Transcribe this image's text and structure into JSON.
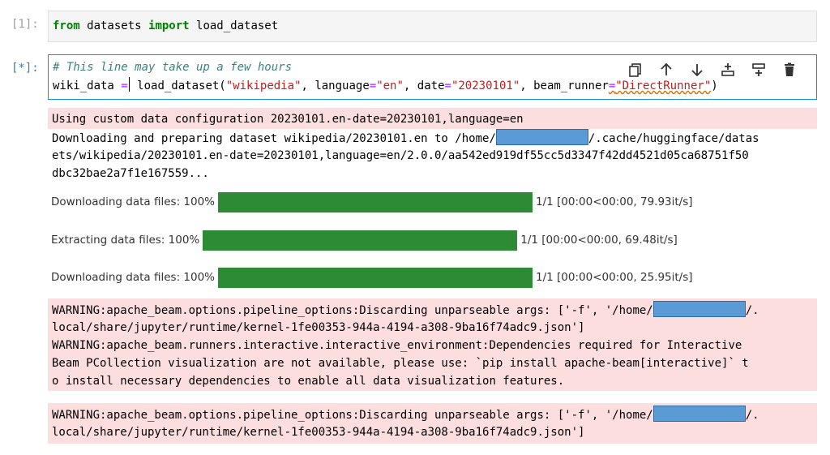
{
  "cells": [
    {
      "prompt": "[1]:",
      "code": {
        "kw1": "from",
        "mod": " datasets ",
        "kw2": "import",
        "rest": " load_dataset"
      }
    },
    {
      "prompt": "[*]:",
      "comment": "# This line may take up a few hours",
      "code_line": {
        "a": "wiki_data ",
        "eq": "=",
        "b": " load_dataset(",
        "s1": "\"wikipedia\"",
        "c": ", language",
        "eq2": "=",
        "s2": "\"en\"",
        "d": ", date",
        "eq3": "=",
        "s3": "\"20230101\"",
        "e": ", beam_runner",
        "eq4": "=",
        "s4": "\"DirectRunner\"",
        "f": ")"
      },
      "toolbar": [
        {
          "icon": "duplicate-icon"
        },
        {
          "icon": "move-up-icon"
        },
        {
          "icon": "move-down-icon"
        },
        {
          "icon": "insert-above-icon"
        },
        {
          "icon": "insert-below-icon"
        },
        {
          "icon": "delete-icon"
        }
      ]
    }
  ],
  "output": {
    "stderr1": {
      "l1": "Using custom data configuration 20230101.en-date=20230101,language=en",
      "l2a": "Downloading and preparing dataset wikipedia/20230101.en to /home/",
      "l2b": "/.cache/huggingface/datas",
      "l3": "ets/wikipedia/20230101.en-date=20230101,language=en/2.0.0/aa542ed919df55cc5d3347f42dd4521d05ca68751f50",
      "l4": "dbc32bae2a7f1e167559..."
    },
    "progress": [
      {
        "label": "Downloading data files: 100%",
        "stats": "1/1 [00:00<00:00, 79.93it/s]",
        "fraction": 1.0
      },
      {
        "label": "Extracting data files: 100%",
        "stats": "1/1 [00:00<00:00, 69.48it/s]",
        "fraction": 1.0
      },
      {
        "label": "Downloading data files: 100%",
        "stats": "1/1 [00:00<00:00, 25.95it/s]",
        "fraction": 1.0
      }
    ],
    "stderr2": {
      "l1a": "WARNING:apache_beam.options.pipeline_options:Discarding unparseable args: ['-f', '/home/",
      "l1b": "/.",
      "l2": "local/share/jupyter/runtime/kernel-1fe00353-944a-4194-a308-9ba16f74adc9.json']",
      "l3": "WARNING:apache_beam.runners.interactive.interactive_environment:Dependencies required for Interactive",
      "l4": "Beam PCollection visualization are not available, please use: `pip install apache-beam[interactive]` t",
      "l5": "o install necessary dependencies to enable all data visualization features."
    },
    "stderr3": {
      "l1a": "WARNING:apache_beam.options.pipeline_options:Discarding unparseable args: ['-f', '/home/",
      "l1b": "/.",
      "l2": "local/share/jupyter/runtime/kernel-1fe00353-944a-4194-a308-9ba16f74adc9.json']"
    }
  },
  "colors": {
    "keyword": "#008000",
    "string": "#ba2121",
    "comment": "#408080",
    "operator": "#aa22ff",
    "progress": "#2e8b35",
    "stderr_bg": "#fcdede",
    "active_border": "#1e88e5",
    "redaction": "#5b9bd5"
  }
}
